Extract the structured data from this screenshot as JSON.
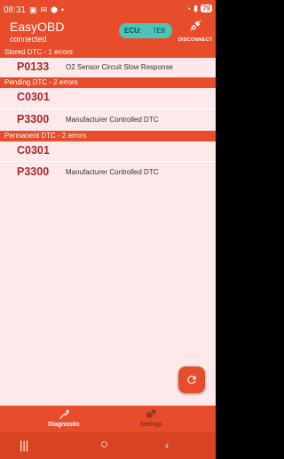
{
  "status_bar": {
    "time": "08:31",
    "battery": "79"
  },
  "app": {
    "title": "EasyOBD",
    "status": "connected"
  },
  "ecu": {
    "label": "ECU:",
    "value": "7E8"
  },
  "disconnect": {
    "label": "DISCONNECT",
    "icon": "plug-icon"
  },
  "sections": {
    "stored": {
      "header": "Stored DTC - 1 errors",
      "rows": [
        {
          "code": "P0133",
          "description": "O2 Sensor Circuit Slow Response"
        }
      ]
    },
    "pending": {
      "header": "Pending DTC - 2 errors",
      "rows": [
        {
          "code": "C0301",
          "description": ""
        },
        {
          "code": "P3300",
          "description": "Manufacturer Controlled DTC"
        }
      ]
    },
    "permanent": {
      "header": "Permanent DTC - 2 errors",
      "rows": [
        {
          "code": "C0301",
          "description": ""
        },
        {
          "code": "P3300",
          "description": "Manufacturer Controlled DTC"
        }
      ]
    }
  },
  "fab": {
    "icon": "refresh-icon"
  },
  "bottom_nav": {
    "diagnostic": "Diagnostic",
    "settings": "Settings"
  },
  "colors": {
    "accent": "#e84d2b",
    "background": "#fde9ea",
    "code": "#a8272b",
    "ecu_chip": "#4ec3b8"
  }
}
